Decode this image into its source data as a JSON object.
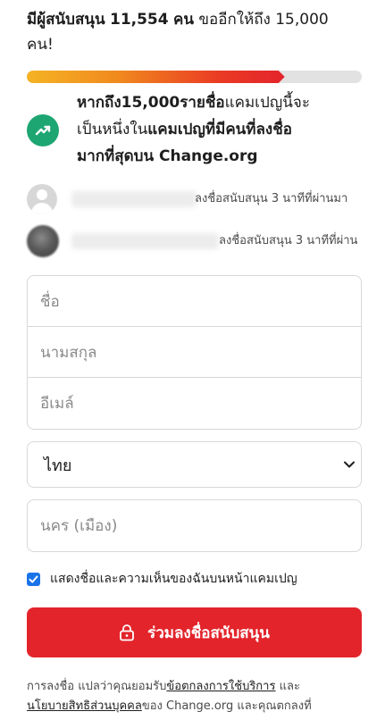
{
  "headline": {
    "prefix": "มีผู้สนับสนุน",
    "count": "11,554",
    "unit": "คน",
    "suffix": "ขออีกให้ถึง 15,000",
    "line2": "คน!"
  },
  "progress": {
    "current": 11554,
    "goal": 15000,
    "fraction": 0.77
  },
  "colors": {
    "accent_red": "#e3242b",
    "milestone_green": "#1ea672",
    "checkbox_blue": "#1a73e8",
    "progress_track": "#e2e2e2"
  },
  "milestone": {
    "icon": "trending-up-icon",
    "bold1": "หากถึง15,000รายชื่อ",
    "light1": "แคมเปญนี้จะ",
    "light2": "เป็นหนึ่งใน",
    "bold2": "แคมเปญที่มีคนที่ลงชื่อ",
    "bold3": "มากที่สุดบน Change.org"
  },
  "recent_signers": [
    {
      "avatar": "default-avatar-icon",
      "text": "ลงชื่อสนับสนุน 3 นาทีที่ผ่านมา"
    },
    {
      "avatar": "photo-avatar",
      "text": "ลงชื่อสนับสนุน 3 นาทีที่ผ่าน"
    }
  ],
  "form": {
    "first_name_placeholder": "ชื่อ",
    "last_name_placeholder": "นามสกุล",
    "email_placeholder": "อีเมล์",
    "country_value": "ไทย",
    "city_placeholder": "นคร (เมือง)",
    "show_name_label": "แสดงชื่อและความเห็นของฉันบนหน้าแคมเปญ",
    "show_name_checked": true,
    "submit_label": "ร่วมลงชื่อสนับสนุน"
  },
  "legal": {
    "part1": "การลงชื่อ แปลว่าคุณยอมรับ",
    "terms_link": "ข้อตกลงการใช้บริการ",
    "part2": " และ",
    "privacy_link": "นโยบายสิทธิส่วนบุคคล",
    "part3": "ของ Change.org และคุณตกลงที่"
  }
}
